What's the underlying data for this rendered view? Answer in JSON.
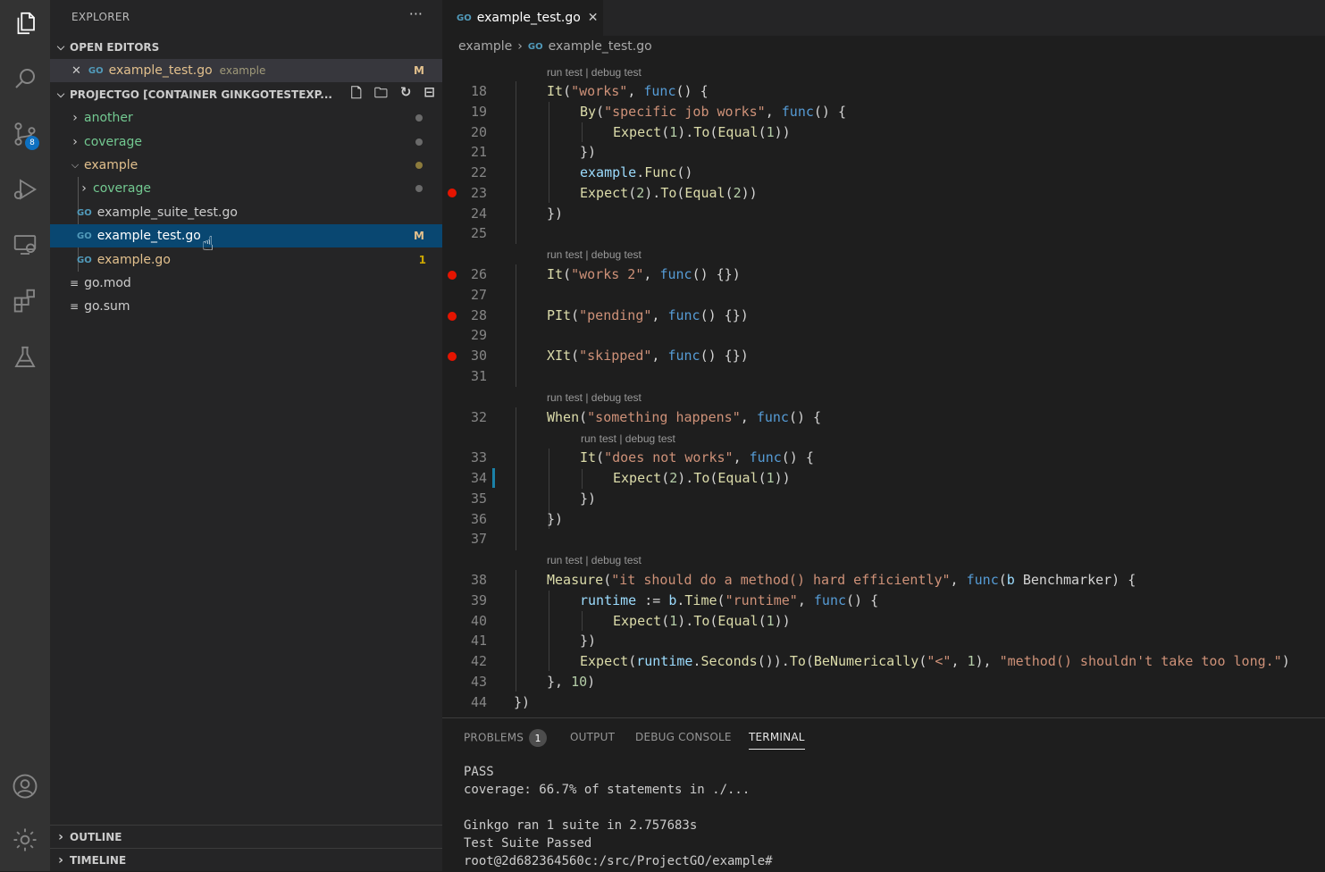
{
  "activity_bar": {
    "scm_badge": "8",
    "icons": [
      "files-icon",
      "search-icon",
      "source-control-icon",
      "run-debug-icon",
      "remote-explorer-icon",
      "extensions-icon",
      "testing-icon",
      "account-icon",
      "settings-gear-icon"
    ]
  },
  "sidebar": {
    "title": "EXPLORER",
    "more": "···",
    "open_editors": {
      "label": "OPEN EDITORS",
      "items": [
        {
          "icon": "GO",
          "name": "example_test.go",
          "desc": "example",
          "status": "M"
        }
      ]
    },
    "project": {
      "label": "PROJECTGO [CONTAINER GINKGOTESTEXP...",
      "items": [
        {
          "type": "folder",
          "name": "another",
          "color": "#73c991"
        },
        {
          "type": "folder",
          "name": "coverage",
          "color": "#73c991"
        },
        {
          "type": "folder-open",
          "name": "example",
          "color": "#e2c08d"
        },
        {
          "type": "folder",
          "name": "coverage",
          "color": "#73c991"
        },
        {
          "type": "file",
          "name": "example_suite_test.go"
        },
        {
          "type": "file",
          "name": "example_test.go",
          "status": "M"
        },
        {
          "type": "file",
          "name": "example.go",
          "status": "1"
        },
        {
          "type": "file",
          "name": "go.mod"
        },
        {
          "type": "file",
          "name": "go.sum"
        }
      ]
    },
    "outline": "OUTLINE",
    "timeline": "TIMELINE"
  },
  "editor": {
    "tab": {
      "icon": "GO",
      "label": "example_test.go",
      "close": "✕"
    },
    "breadcrumb": {
      "folder": "example",
      "sep": "›",
      "file": "example_test.go"
    },
    "codelens": "run test | debug test",
    "line_numbers": [
      "18",
      "19",
      "20",
      "21",
      "22",
      "23",
      "24",
      "25",
      "26",
      "27",
      "28",
      "29",
      "30",
      "31",
      "32",
      "33",
      "34",
      "35",
      "36",
      "37",
      "38",
      "39",
      "40",
      "41",
      "42",
      "43",
      "44"
    ]
  },
  "panel": {
    "tabs": {
      "problems": "PROBLEMS",
      "problems_count": "1",
      "output": "OUTPUT",
      "debug_console": "DEBUG CONSOLE",
      "terminal": "TERMINAL"
    },
    "terminal_lines": "PASS\ncoverage: 66.7% of statements in ./...\n\nGinkgo ran 1 suite in 2.757683s\nTest Suite Passed\nroot@2d682364560c:/src/ProjectGO/example#"
  }
}
